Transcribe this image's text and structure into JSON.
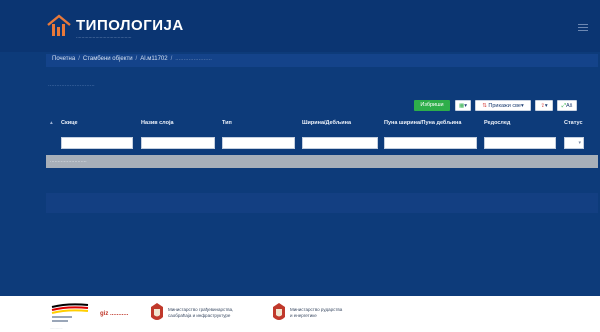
{
  "header": {
    "brand": "ТИПОЛОГИЈА",
    "brand_subtitle": "........................................"
  },
  "breadcrumb": {
    "items": [
      "Почетна",
      "Стамбени објекти",
      "Al.м11702"
    ],
    "separator": "/",
    "current": "......................"
  },
  "panel": {
    "title": "............................"
  },
  "toolbar": {
    "search_label": "Избриши",
    "columns_label": "Прикажи све",
    "export_label": "⇪",
    "all_label": "Aš"
  },
  "table": {
    "columns": [
      "Скице",
      "Назив слоја",
      "Тип",
      "Ширина/Дебљина",
      "Пуна ширина/Пуна дебљина",
      "Редослед",
      "Статус"
    ],
    "empty_text": "........................"
  },
  "footer": {
    "partner_1": "...............",
    "partner_2": "giz ...........",
    "ministry_1": [
      "Министарство грађевинарства,",
      "саобраћаја и инфраструктуре"
    ],
    "ministry_2": [
      "Министарство рударства",
      "и енергетике"
    ]
  },
  "colors": {
    "app_bg": "#0d3b7a",
    "accent_green": "#2eae4a",
    "empty_row": "#a7afb9"
  }
}
